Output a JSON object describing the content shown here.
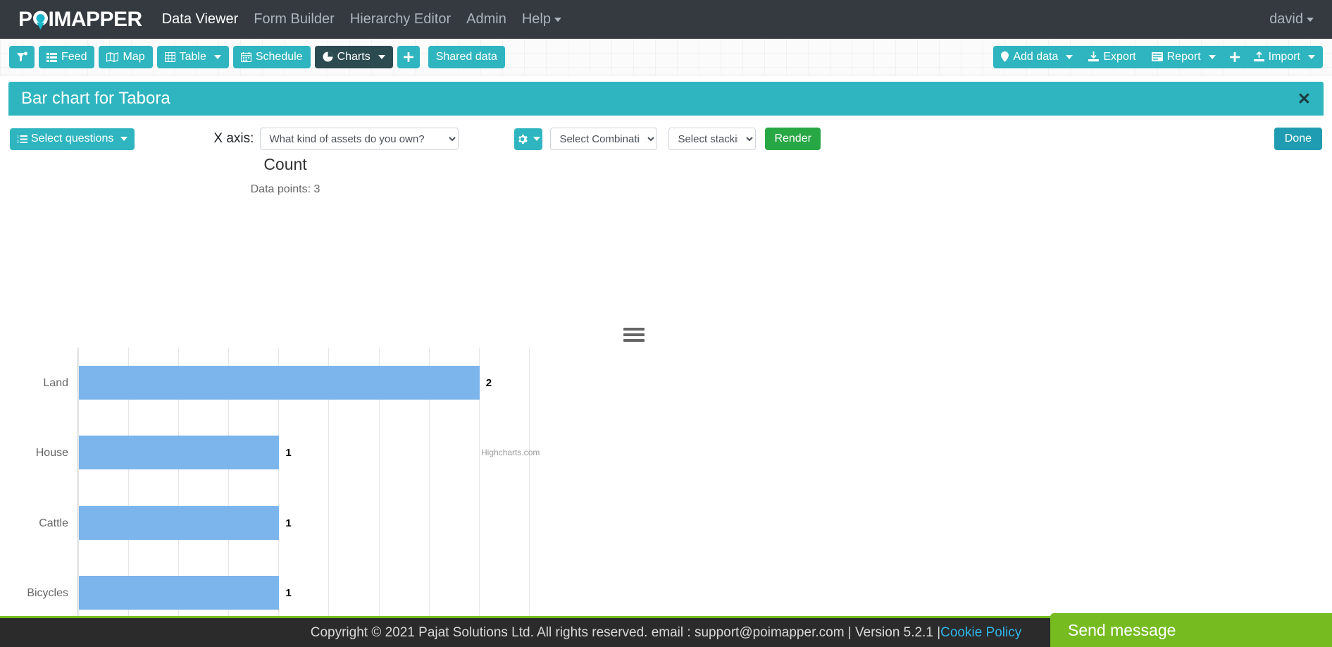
{
  "topnav": {
    "brand": "POIMAPPER",
    "brand_pre": "P",
    "brand_post": "IMAPPER",
    "links": [
      {
        "label": "Data Viewer",
        "active": true,
        "caret": false
      },
      {
        "label": "Form Builder",
        "active": false,
        "caret": false
      },
      {
        "label": "Hierarchy Editor",
        "active": false,
        "caret": false
      },
      {
        "label": "Admin",
        "active": false,
        "caret": false
      },
      {
        "label": "Help",
        "active": false,
        "caret": true
      }
    ],
    "user": "david"
  },
  "toolbar": {
    "filter_label": "",
    "feed_label": "Feed",
    "map_label": "Map",
    "table_label": "Table",
    "schedule_label": "Schedule",
    "charts_label": "Charts",
    "plus_label": "+",
    "shared_data_label": "Shared data",
    "add_data_label": "Add data",
    "export_label": "Export",
    "report_label": "Report",
    "plus_right_label": "+",
    "import_label": "Import"
  },
  "panel": {
    "title": "Bar chart for Tabora",
    "close_label": "✕"
  },
  "controls": {
    "select_questions_label": "Select questions",
    "x_axis_label": "X axis:",
    "x_axis_value": "What kind of assets do you own?",
    "gear_label": "",
    "combination_value": "Select Combination",
    "stacking_value": "Select stacking",
    "render_label": "Render",
    "done_label": "Done"
  },
  "chart_data": {
    "type": "bar",
    "title": "Count",
    "subtitle": "Data points: 3",
    "categories": [
      "Land",
      "House",
      "Cattle",
      "Bicycles"
    ],
    "values": [
      2,
      1,
      1,
      1
    ],
    "data_labels": [
      "2",
      "1",
      "1",
      "1"
    ],
    "xlabel": "",
    "ylabel": "",
    "xlim": [
      0,
      2.3
    ],
    "xticks": [
      "0",
      "0.25",
      "0.5",
      "0.75",
      "1",
      "1.25",
      "1.5",
      "1.75",
      "2",
      "2.25"
    ],
    "xtick_values": [
      0,
      0.25,
      0.5,
      0.75,
      1,
      1.25,
      1.5,
      1.75,
      2,
      2.25
    ],
    "grid": true,
    "legend": false,
    "bar_color": "#7cb5ec",
    "credit": "Highcharts.com"
  },
  "footer": {
    "text": "Copyright © 2021 Pajat Solutions Ltd. All rights reserved. email : support@poimapper.com | Version 5.2.1 | ",
    "link_label": "Cookie Policy"
  },
  "chat": {
    "send_message_label": "Send message"
  },
  "colors": {
    "brand_teal": "#2fb5c0",
    "nav_dark": "#343a40",
    "render_green": "#28a745",
    "bar_blue": "#7cb5ec",
    "footer_green": "#76bc21",
    "link_blue": "#2fb5e8"
  }
}
